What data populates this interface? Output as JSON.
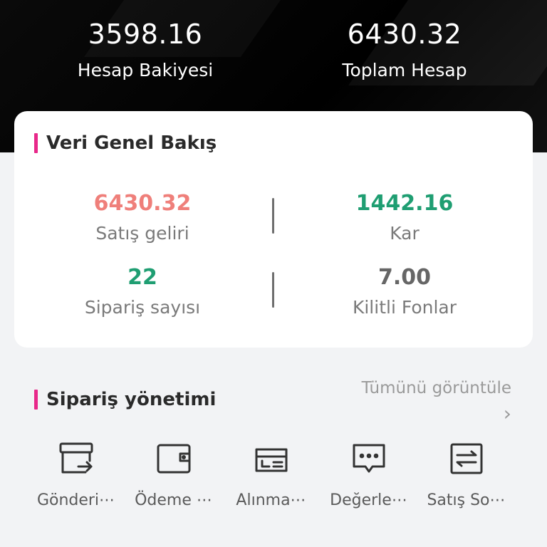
{
  "header": {
    "balance_value": "3598.16",
    "balance_label": "Hesap Bakiyesi",
    "total_value": "6430.32",
    "total_label": "Toplam Hesap"
  },
  "overview": {
    "title": "Veri Genel Bakış",
    "accent_color": "#e8288a",
    "metrics": [
      {
        "value": "6430.32",
        "label": "Satış geliri",
        "color": "#ef7f7a"
      },
      {
        "value": "1442.16",
        "label": "Kar",
        "color": "#1f9e72"
      },
      {
        "value": "22",
        "label": "Sipariş sayısı",
        "color": "#1f9e72"
      },
      {
        "value": "7.00",
        "label": "Kilitli Fonlar",
        "color": "#666666"
      }
    ]
  },
  "orders": {
    "title": "Sipariş yönetimi",
    "view_all": "Tümünü görüntüle",
    "items": [
      {
        "label": "Gönderi⋯",
        "icon": "shipping-box-icon"
      },
      {
        "label": "Ödeme ⋯",
        "icon": "wallet-icon"
      },
      {
        "label": "Alınma⋯",
        "icon": "receive-card-icon"
      },
      {
        "label": "Değerle⋯",
        "icon": "review-chat-icon"
      },
      {
        "label": "Satış So⋯",
        "icon": "after-sales-icon"
      }
    ]
  }
}
